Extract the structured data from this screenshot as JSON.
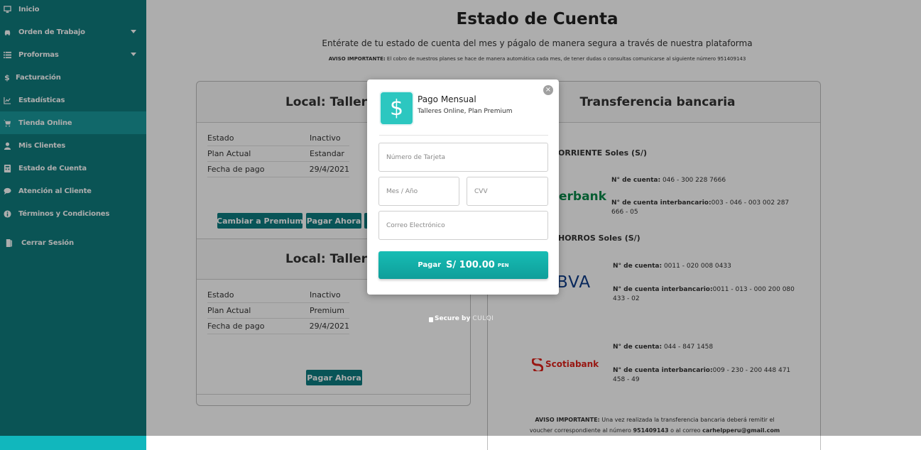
{
  "sidebar": {
    "items": [
      {
        "label": "Inicio"
      },
      {
        "label": "Orden de Trabajo"
      },
      {
        "label": "Proformas"
      },
      {
        "label": "Facturación"
      },
      {
        "label": "Estadísticas"
      },
      {
        "label": "Tienda Online"
      },
      {
        "label": "Mis Clientes"
      },
      {
        "label": "Estado de Cuenta"
      },
      {
        "label": "Atención al Cliente"
      },
      {
        "label": "Términos y Condiciones"
      },
      {
        "label": "Cerrar Sesión"
      }
    ]
  },
  "page": {
    "title": "Estado de Cuenta",
    "subtitle": "Entérate de tu estado de cuenta del mes y págalo de manera segura a través de nuestra plataforma",
    "notice_label": "AVISO IMPORTANTE:",
    "notice_text": "El cobro de nuestros planes se hace de manera automática cada mes, de tener dudas o consultas comunicarse al siguiente número 951409143"
  },
  "locals": [
    {
      "heading": "Local: Taller",
      "rows": [
        {
          "key": "Estado",
          "value": "Inactivo"
        },
        {
          "key": "Plan Actual",
          "value": "Estandar"
        },
        {
          "key": "Fecha de pago",
          "value": "29/4/2021"
        }
      ],
      "buttons": [
        "Cambiar a Premium",
        "Pagar Ahora"
      ]
    },
    {
      "heading": "Local: Taller",
      "rows": [
        {
          "key": "Estado",
          "value": "Inactivo"
        },
        {
          "key": "Plan Actual",
          "value": "Premium"
        },
        {
          "key": "Fecha de pago",
          "value": "29/4/2021"
        }
      ],
      "buttons": [
        "Pagar Ahora"
      ]
    }
  ],
  "transfer": {
    "heading": "Transferencia bancaria",
    "section1_title": "ORRIENTE Soles (S/)",
    "section2_title": "HORROS Soles (S/)",
    "banks": [
      {
        "logo": "erbank",
        "cuenta_label": "N° de cuenta:",
        "cuenta": "046 - 300 228 7666",
        "cci_label": "N° de cuenta interbancario:",
        "cci_1": "003 - 046 - 003 002 287",
        "cci_2": "666 - 05"
      },
      {
        "logo": "BVA",
        "cuenta_label": "N° de cuenta:",
        "cuenta": "0011 - 020 008 0433",
        "cci_label": "N° de cuenta interbancario:",
        "cci_1": "0011 - 013 - 000 200 080",
        "cci_2": "433 - 02"
      },
      {
        "logo": "Scotiabank",
        "cuenta_label": "N° de cuenta:",
        "cuenta": "044 - 847 1458",
        "cci_label": "N° de cuenta interbancario:",
        "cci_1": "009 - 230 - 200 448 471",
        "cci_2": "458 - 49"
      }
    ],
    "footer_label": "AVISO IMPORTANTE:",
    "footer_text1": "Una vez realizada la transferencia bancaria deberá remitir el",
    "footer_text2a": "voucher correspondiente al número",
    "footer_phone": "951409143",
    "footer_text2b": "o al correo",
    "footer_email": "carhelpperu@gmail.com"
  },
  "modal": {
    "logo_symbol": "$",
    "title": "Pago Mensual",
    "subtitle": "Talleres Online, Plan Premium",
    "close_symbol": "×",
    "card_placeholder": "Número de Tarjeta",
    "expiry_placeholder": "Mes / Año",
    "cvv_placeholder": "CVV",
    "email_placeholder": "Correo Electrónico",
    "pay_label": "Pagar",
    "pay_amount": "S/ 100.00",
    "pay_currency": "PEN",
    "secure_label": "Secure by",
    "secure_brand": "CULQI"
  },
  "colors": {
    "sidebar": "#0f7c7e",
    "accent": "#11b7bd",
    "button": "#0d7c80"
  }
}
